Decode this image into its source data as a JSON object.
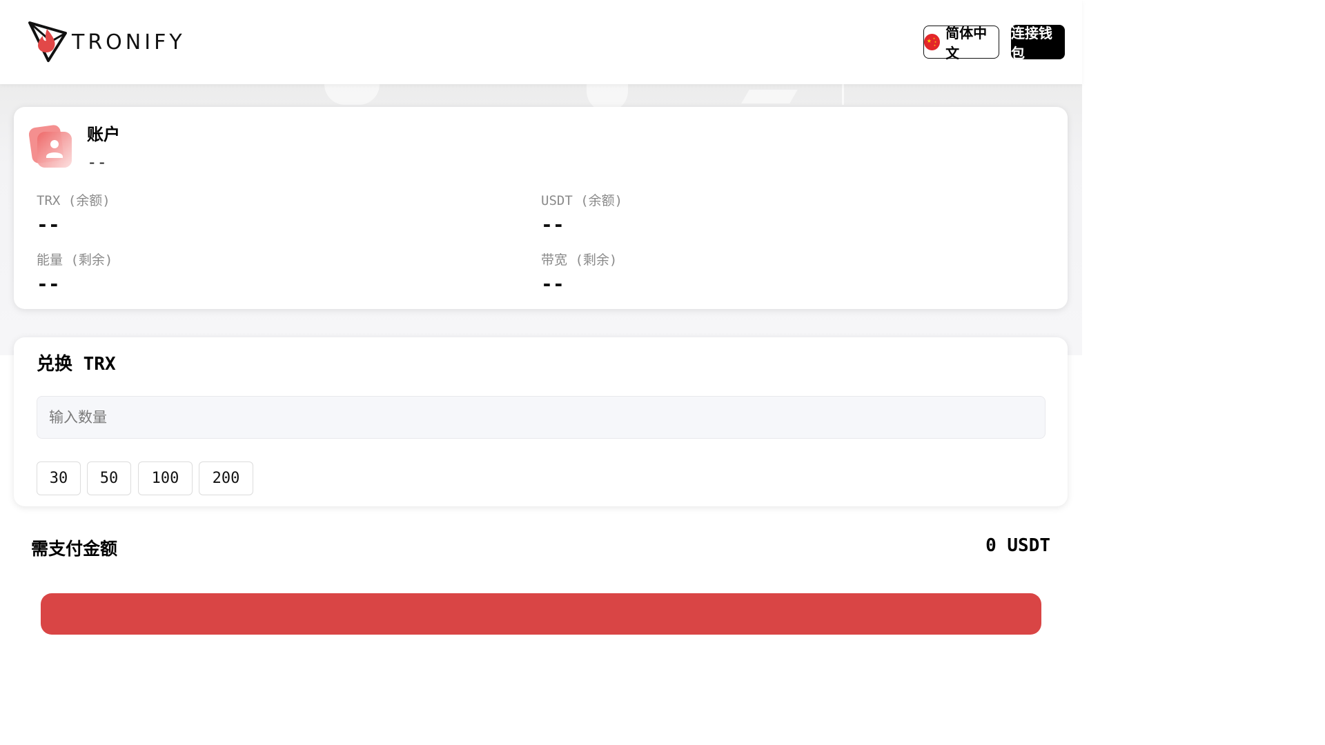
{
  "header": {
    "logo_text": "TRONIFY",
    "language_label": "简体中文",
    "connect_label": "连接钱包"
  },
  "account": {
    "title": "账户",
    "address": "--",
    "stats": [
      {
        "label": "TRX (余额)",
        "value": "--"
      },
      {
        "label": "USDT (余额)",
        "value": "--"
      },
      {
        "label": "能量 (剩余)",
        "value": "--"
      },
      {
        "label": "带宽 (剩余)",
        "value": "--"
      }
    ]
  },
  "exchange": {
    "title": "兑换 TRX",
    "amount_placeholder": "输入数量",
    "presets": [
      "30",
      "50",
      "100",
      "200"
    ]
  },
  "payment": {
    "label": "需支付金额",
    "amount": "0 USDT"
  },
  "colors": {
    "accent": "#d94545",
    "primary_button": "#000000",
    "input_bg": "#f6f7fa"
  }
}
